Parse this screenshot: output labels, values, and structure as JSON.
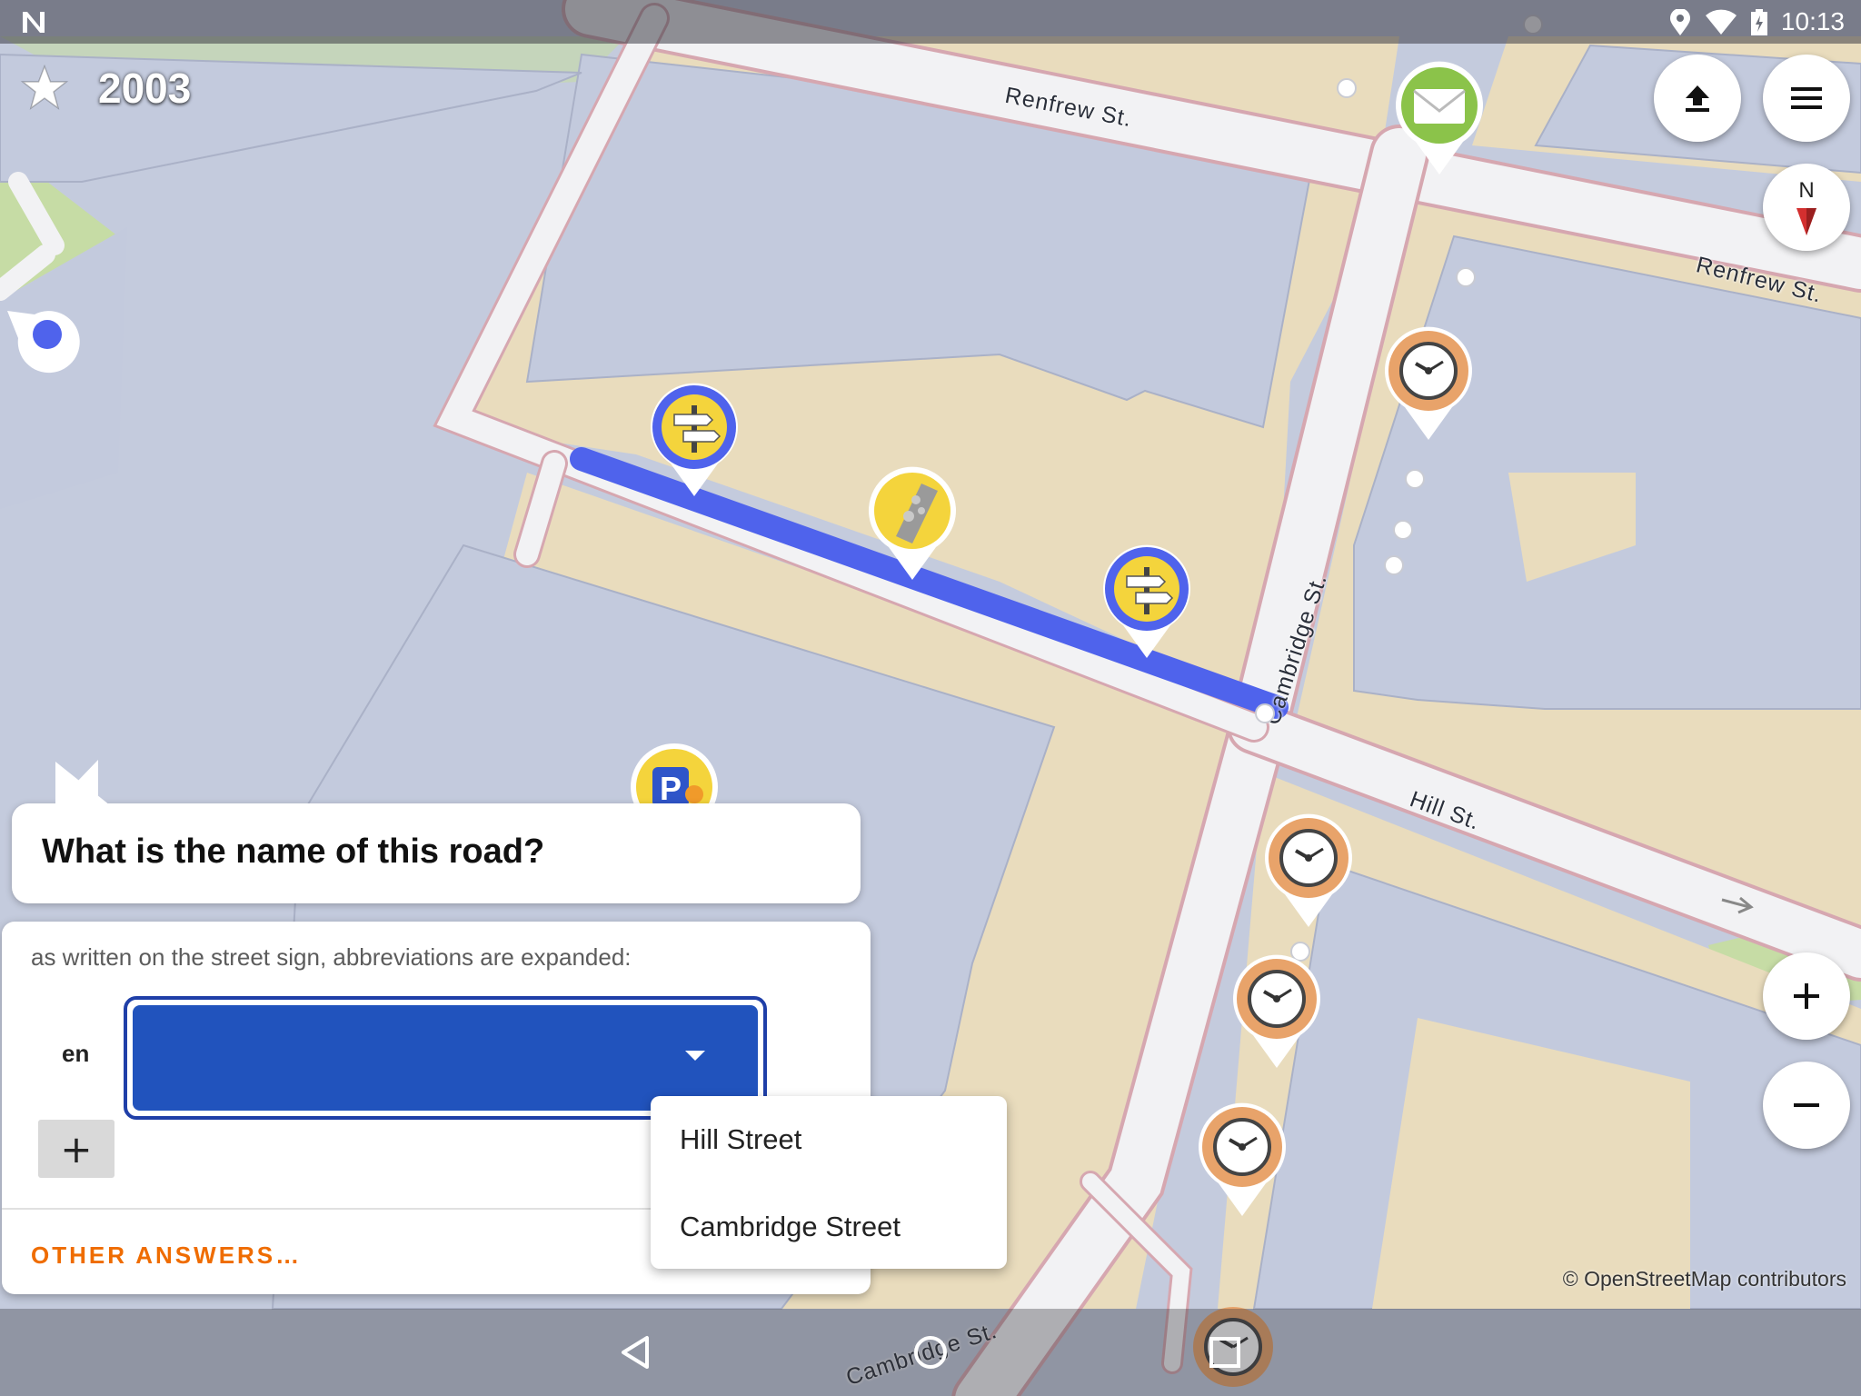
{
  "status_bar": {
    "time": "10:13",
    "icons": [
      "notification-n-icon",
      "location-icon",
      "wifi-icon",
      "battery-icon"
    ]
  },
  "counter": {
    "icon": "star-icon",
    "value": "2003"
  },
  "map": {
    "street_labels": {
      "renfrew_top": "Renfrew St.",
      "renfrew_right": "Renfrew St.",
      "cambridge_vertical": "Cambridge St.",
      "hill": "Hill St.",
      "cambridge_bottom": "Cambridge St."
    },
    "attribution": "© OpenStreetMap contributors",
    "compass_label": "N",
    "colors": {
      "building": "#c3cadd",
      "block_fill": "#e9dcbd",
      "road": "#f2f2f4",
      "road_edge": "#d6a7b0",
      "highlight": "#4f63ec",
      "green": "#c6dca5"
    }
  },
  "map_buttons": {
    "upload": "upload-icon",
    "menu": "menu-icon",
    "compass": "compass-icon",
    "zoom_in": "zoom-in-icon",
    "zoom_out": "zoom-out-icon"
  },
  "quest": {
    "title": "What is the name of this road?",
    "hint": "as written on the street sign, abbreviations are expanded:",
    "language": "en",
    "name_value": "",
    "add_button": "+",
    "other_answers": "OTHER ANSWERS…",
    "suggestions": [
      "Hill Street",
      "Cambridge Street"
    ]
  },
  "nav_bar": {
    "back": "back-icon",
    "home": "home-icon",
    "recents": "recents-icon"
  }
}
